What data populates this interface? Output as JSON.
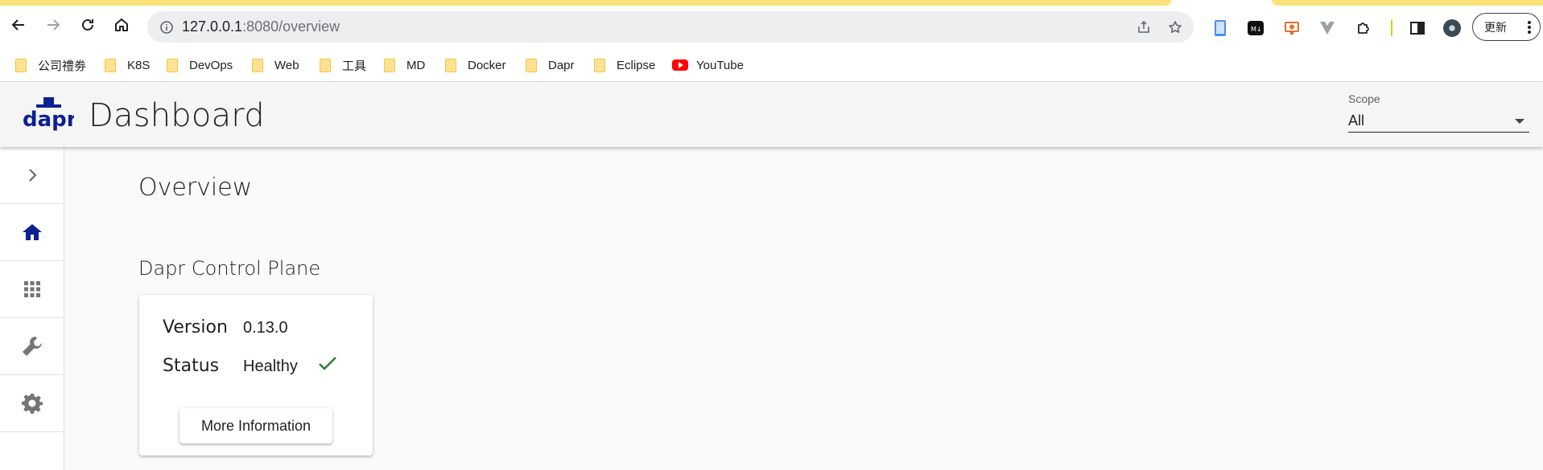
{
  "browser": {
    "url_host": "127.0.0.1",
    "url_rest": ":8080/overview",
    "update_label": "更新",
    "bookmarks": [
      {
        "label": "公司禮劵",
        "icon": "folder-icon"
      },
      {
        "label": "K8S",
        "icon": "folder-icon"
      },
      {
        "label": "DevOps",
        "icon": "folder-icon"
      },
      {
        "label": "Web",
        "icon": "folder-icon"
      },
      {
        "label": "工具",
        "icon": "folder-icon"
      },
      {
        "label": "MD",
        "icon": "folder-icon"
      },
      {
        "label": "Docker",
        "icon": "folder-icon"
      },
      {
        "label": "Dapr",
        "icon": "folder-icon"
      },
      {
        "label": "Eclipse",
        "icon": "folder-icon"
      },
      {
        "label": "YouTube",
        "icon": "youtube-icon"
      }
    ],
    "extensions": [
      "phone-extension-icon",
      "markdown-extension-icon",
      "monitor-extension-icon",
      "vue-devtools-icon",
      "puzzle-extensions-icon",
      "side-panel-icon",
      "profile-avatar-icon"
    ]
  },
  "app": {
    "logo_text": "dapr",
    "title": "Dashboard",
    "scope": {
      "label": "Scope",
      "value": "All"
    }
  },
  "sidebar": {
    "items": [
      {
        "name": "expand",
        "icon": "chevron-right-icon"
      },
      {
        "name": "overview",
        "icon": "home-icon",
        "active": true
      },
      {
        "name": "applications",
        "icon": "apps-grid-icon"
      },
      {
        "name": "components",
        "icon": "wrench-icon"
      },
      {
        "name": "configurations",
        "icon": "settings-icon"
      }
    ]
  },
  "main": {
    "page_title": "Overview",
    "section_title": "Dapr Control Plane",
    "card": {
      "version_label": "Version",
      "version_value": "0.13.0",
      "status_label": "Status",
      "status_value": "Healthy",
      "button_label": "More Information"
    }
  },
  "colors": {
    "brand": "#0d2192",
    "healthy": "#2e7d32",
    "tab_accent": "#fbe27a"
  }
}
